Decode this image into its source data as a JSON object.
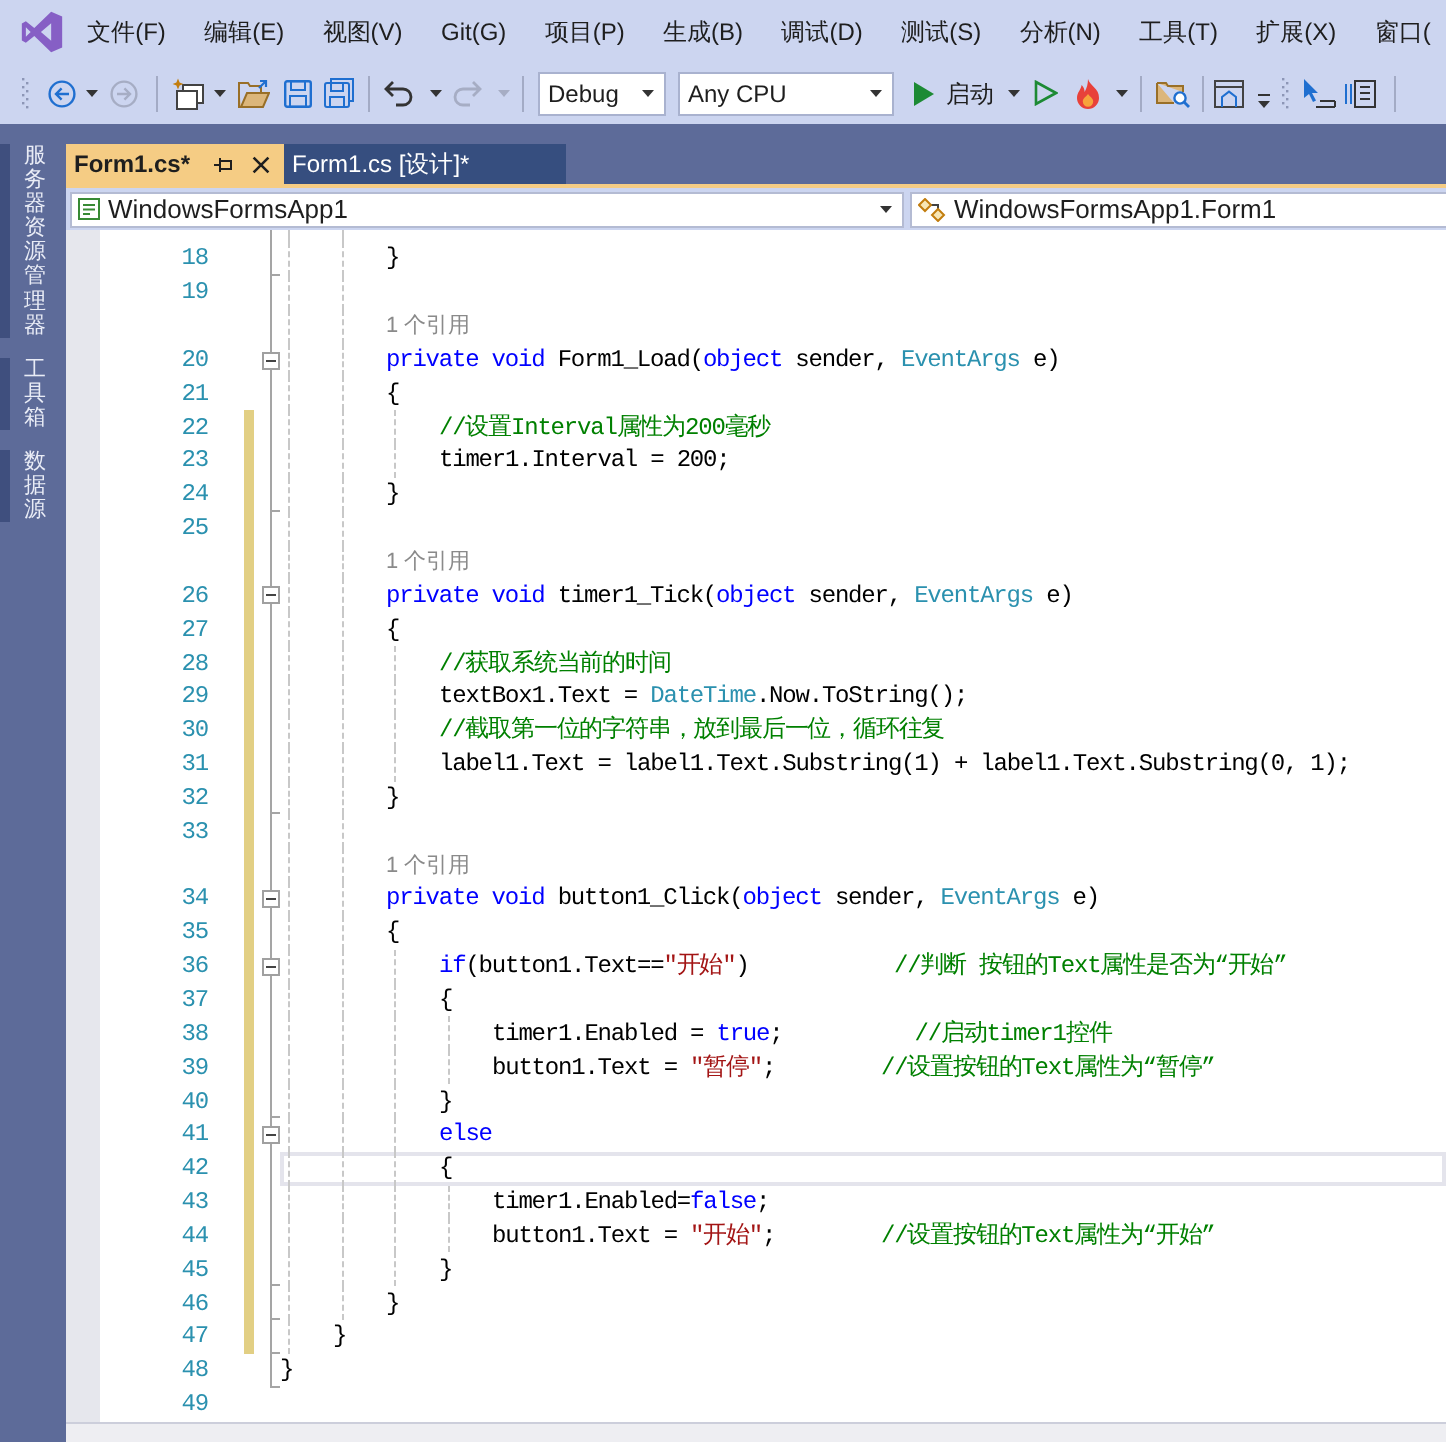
{
  "menu_bar": {
    "items": [
      "文件(F)",
      "编辑(E)",
      "视图(V)",
      "Git(G)",
      "项目(P)",
      "生成(B)",
      "调试(D)",
      "测试(S)",
      "分析(N)",
      "工具(T)",
      "扩展(X)",
      "窗口("
    ]
  },
  "toolbar": {
    "back": {
      "disabled": false
    },
    "forward": {
      "disabled": true
    },
    "undo": {
      "disabled": false
    },
    "redo": {
      "disabled": true
    },
    "configuration": "Debug",
    "platform": "Any CPU",
    "start_label": "启动"
  },
  "side_panel": {
    "tabs": [
      "服务器资源管理器",
      "工具箱",
      "数据源"
    ]
  },
  "document_tabs": [
    {
      "label": "Form1.cs*",
      "selected": true
    },
    {
      "label": "Form1.cs [设计]*",
      "selected": false
    }
  ],
  "navigation_bar": {
    "project": "WindowsFormsApp1",
    "type": "WindowsFormsApp1.Form1"
  },
  "editor": {
    "rows": [
      {
        "kind": "code",
        "number": "18",
        "modified": false,
        "current": false,
        "block_end": true,
        "tokens": [
          {
            "kind": "plain",
            "text": "        }"
          }
        ]
      },
      {
        "kind": "code",
        "number": "19",
        "modified": false,
        "current": false,
        "block_end": false
      },
      {
        "kind": "codelens",
        "text": "1 个引用",
        "modified": false,
        "current": false
      },
      {
        "kind": "code",
        "number": "20",
        "modified": false,
        "current": false,
        "block_end": false,
        "expanded": true,
        "tokens": [
          {
            "kind": "keyword",
            "text": "        private void"
          },
          {
            "kind": "plain",
            "text": " Form1_Load("
          },
          {
            "kind": "keyword",
            "text": "object"
          },
          {
            "kind": "plain",
            "text": " sender, "
          },
          {
            "kind": "type",
            "text": "EventArgs"
          },
          {
            "kind": "plain",
            "text": " e)"
          }
        ]
      },
      {
        "kind": "code",
        "number": "21",
        "modified": false,
        "current": false,
        "block_end": false,
        "tokens": [
          {
            "kind": "plain",
            "text": "        {"
          }
        ]
      },
      {
        "kind": "code",
        "number": "22",
        "modified": true,
        "current": false,
        "block_end": false,
        "tokens": [
          {
            "kind": "comment",
            "text": "            //设置Interval属性为200毫秒"
          }
        ]
      },
      {
        "kind": "code",
        "number": "23",
        "modified": true,
        "current": false,
        "block_end": false,
        "tokens": [
          {
            "kind": "plain",
            "text": "            timer1.Interval = 200;"
          }
        ]
      },
      {
        "kind": "code",
        "number": "24",
        "modified": true,
        "current": false,
        "block_end": true,
        "tokens": [
          {
            "kind": "plain",
            "text": "        }"
          }
        ]
      },
      {
        "kind": "code",
        "number": "25",
        "modified": true,
        "current": false,
        "block_end": false
      },
      {
        "kind": "codelens",
        "text": "1 个引用",
        "modified": true,
        "current": false
      },
      {
        "kind": "code",
        "number": "26",
        "modified": true,
        "current": false,
        "block_end": false,
        "expanded": true,
        "tokens": [
          {
            "kind": "keyword",
            "text": "        private void"
          },
          {
            "kind": "plain",
            "text": " timer1_Tick("
          },
          {
            "kind": "keyword",
            "text": "object"
          },
          {
            "kind": "plain",
            "text": " sender, "
          },
          {
            "kind": "type",
            "text": "EventArgs"
          },
          {
            "kind": "plain",
            "text": " e)"
          }
        ]
      },
      {
        "kind": "code",
        "number": "27",
        "modified": true,
        "current": false,
        "block_end": false,
        "tokens": [
          {
            "kind": "plain",
            "text": "        {"
          }
        ]
      },
      {
        "kind": "code",
        "number": "28",
        "modified": true,
        "current": false,
        "block_end": false,
        "tokens": [
          {
            "kind": "comment",
            "text": "            //获取系统当前的时间"
          }
        ]
      },
      {
        "kind": "code",
        "number": "29",
        "modified": true,
        "current": false,
        "block_end": false,
        "tokens": [
          {
            "kind": "plain",
            "text": "            textBox1.Text = "
          },
          {
            "kind": "type",
            "text": "DateTime"
          },
          {
            "kind": "plain",
            "text": ".Now.ToString();"
          }
        ]
      },
      {
        "kind": "code",
        "number": "30",
        "modified": true,
        "current": false,
        "block_end": false,
        "tokens": [
          {
            "kind": "comment",
            "text": "            //截取第一位的字符串，放到最后一位，循环往复"
          }
        ]
      },
      {
        "kind": "code",
        "number": "31",
        "modified": true,
        "current": false,
        "block_end": false,
        "tokens": [
          {
            "kind": "plain",
            "text": "            label1.Text = label1.Text.Substring(1) + label1.Text.Substring(0, 1);"
          }
        ]
      },
      {
        "kind": "code",
        "number": "32",
        "modified": true,
        "current": false,
        "block_end": true,
        "tokens": [
          {
            "kind": "plain",
            "text": "        }"
          }
        ]
      },
      {
        "kind": "code",
        "number": "33",
        "modified": true,
        "current": false,
        "block_end": false
      },
      {
        "kind": "codelens",
        "text": "1 个引用",
        "modified": true,
        "current": false
      },
      {
        "kind": "code",
        "number": "34",
        "modified": true,
        "current": false,
        "block_end": false,
        "expanded": true,
        "tokens": [
          {
            "kind": "keyword",
            "text": "        private void"
          },
          {
            "kind": "plain",
            "text": " button1_Click("
          },
          {
            "kind": "keyword",
            "text": "object"
          },
          {
            "kind": "plain",
            "text": " sender, "
          },
          {
            "kind": "type",
            "text": "EventArgs"
          },
          {
            "kind": "plain",
            "text": " e)"
          }
        ]
      },
      {
        "kind": "code",
        "number": "35",
        "modified": true,
        "current": false,
        "block_end": false,
        "tokens": [
          {
            "kind": "plain",
            "text": "        {"
          }
        ]
      },
      {
        "kind": "code",
        "number": "36",
        "modified": true,
        "current": false,
        "block_end": false,
        "expanded": true,
        "tokens": [
          {
            "kind": "keyword",
            "text": "            if"
          },
          {
            "kind": "plain",
            "text": "(button1.Text=="
          },
          {
            "kind": "string",
            "text": "\"开始\""
          },
          {
            "kind": "plain",
            "text": ")           "
          },
          {
            "kind": "comment",
            "text": "//判断 按钮的Text属性是否为“开始”"
          }
        ]
      },
      {
        "kind": "code",
        "number": "37",
        "modified": true,
        "current": false,
        "block_end": false,
        "tokens": [
          {
            "kind": "plain",
            "text": "            {"
          }
        ]
      },
      {
        "kind": "code",
        "number": "38",
        "modified": true,
        "current": false,
        "block_end": false,
        "tokens": [
          {
            "kind": "plain",
            "text": "                timer1.Enabled = "
          },
          {
            "kind": "keyword",
            "text": "true"
          },
          {
            "kind": "plain",
            "text": ";          "
          },
          {
            "kind": "comment",
            "text": "//启动timer1控件"
          }
        ]
      },
      {
        "kind": "code",
        "number": "39",
        "modified": true,
        "current": false,
        "block_end": false,
        "tokens": [
          {
            "kind": "plain",
            "text": "                button1.Text = "
          },
          {
            "kind": "string",
            "text": "\"暂停\""
          },
          {
            "kind": "plain",
            "text": ";        "
          },
          {
            "kind": "comment",
            "text": "//设置按钮的Text属性为“暂停”"
          }
        ]
      },
      {
        "kind": "code",
        "number": "40",
        "modified": true,
        "current": false,
        "block_end": true,
        "tokens": [
          {
            "kind": "plain",
            "text": "            }"
          }
        ]
      },
      {
        "kind": "code",
        "number": "41",
        "modified": true,
        "current": false,
        "block_end": false,
        "expanded": true,
        "tokens": [
          {
            "kind": "keyword",
            "text": "            else"
          }
        ]
      },
      {
        "kind": "code",
        "number": "42",
        "modified": true,
        "current": true,
        "block_end": false,
        "tokens": [
          {
            "kind": "plain",
            "text": "            {"
          }
        ]
      },
      {
        "kind": "code",
        "number": "43",
        "modified": true,
        "current": false,
        "block_end": false,
        "tokens": [
          {
            "kind": "plain",
            "text": "                timer1.Enabled="
          },
          {
            "kind": "keyword",
            "text": "false"
          },
          {
            "kind": "plain",
            "text": ";"
          }
        ]
      },
      {
        "kind": "code",
        "number": "44",
        "modified": true,
        "current": false,
        "block_end": false,
        "tokens": [
          {
            "kind": "plain",
            "text": "                button1.Text = "
          },
          {
            "kind": "string",
            "text": "\"开始\""
          },
          {
            "kind": "plain",
            "text": ";        "
          },
          {
            "kind": "comment",
            "text": "//设置按钮的Text属性为“开始”"
          }
        ]
      },
      {
        "kind": "code",
        "number": "45",
        "modified": true,
        "current": false,
        "block_end": true,
        "tokens": [
          {
            "kind": "plain",
            "text": "            }"
          }
        ]
      },
      {
        "kind": "code",
        "number": "46",
        "modified": true,
        "current": false,
        "block_end": true,
        "tokens": [
          {
            "kind": "plain",
            "text": "        }"
          }
        ]
      },
      {
        "kind": "code",
        "number": "47",
        "modified": true,
        "current": false,
        "block_end": true,
        "tokens": [
          {
            "kind": "plain",
            "text": "    }"
          }
        ]
      },
      {
        "kind": "code",
        "number": "48",
        "modified": false,
        "current": false,
        "block_end": true,
        "tokens": [
          {
            "kind": "plain",
            "text": "}"
          }
        ]
      },
      {
        "kind": "code",
        "number": "49",
        "modified": false,
        "current": false,
        "block_end": false
      }
    ]
  }
}
